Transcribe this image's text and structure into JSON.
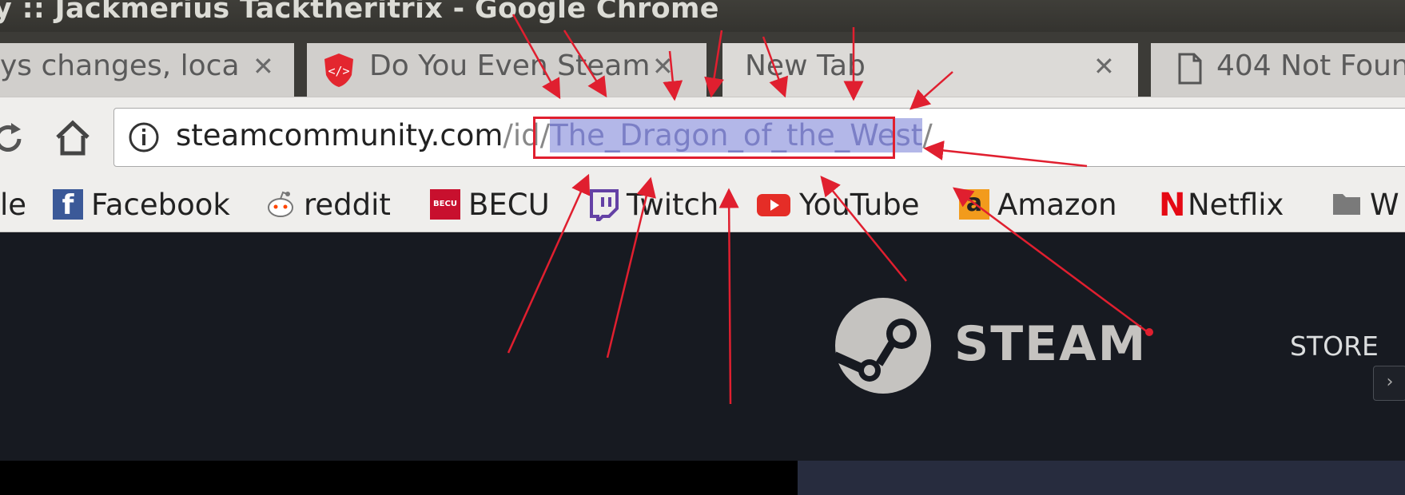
{
  "window": {
    "title": "y :: Jackmerius Tacktheritrix - Google Chrome"
  },
  "tabs": [
    {
      "label": "ys changes, loca",
      "icon": "page-icon"
    },
    {
      "label": "Do You Even Steam",
      "icon": "shield-code-icon"
    },
    {
      "label": "New Tab",
      "icon": ""
    },
    {
      "label": "404 Not Foun",
      "icon": "document-icon"
    }
  ],
  "tab_close_glyph": "✕",
  "toolbar": {
    "url_host": "steamcommunity.com",
    "url_path_prefix": "/id/",
    "url_selected": "The_Dragon_of_the_West",
    "url_suffix": "/"
  },
  "bookmarks": [
    {
      "label": "le",
      "icon": "google-icon"
    },
    {
      "label": "Facebook",
      "icon": "facebook-icon"
    },
    {
      "label": "reddit",
      "icon": "reddit-icon"
    },
    {
      "label": "BECU",
      "icon": "becu-icon"
    },
    {
      "label": "Twitch",
      "icon": "twitch-icon"
    },
    {
      "label": "YouTube",
      "icon": "youtube-icon"
    },
    {
      "label": "Amazon",
      "icon": "amazon-icon"
    },
    {
      "label": "Netflix",
      "icon": "netflix-icon"
    },
    {
      "label": "W",
      "icon": "folder-icon"
    }
  ],
  "page": {
    "steam_wordmark": "STEAM",
    "nav_store": "STORE",
    "scroll_glyph": "›"
  },
  "colors": {
    "annotation": "#e01f2f",
    "steam_bg": "#171a21"
  }
}
